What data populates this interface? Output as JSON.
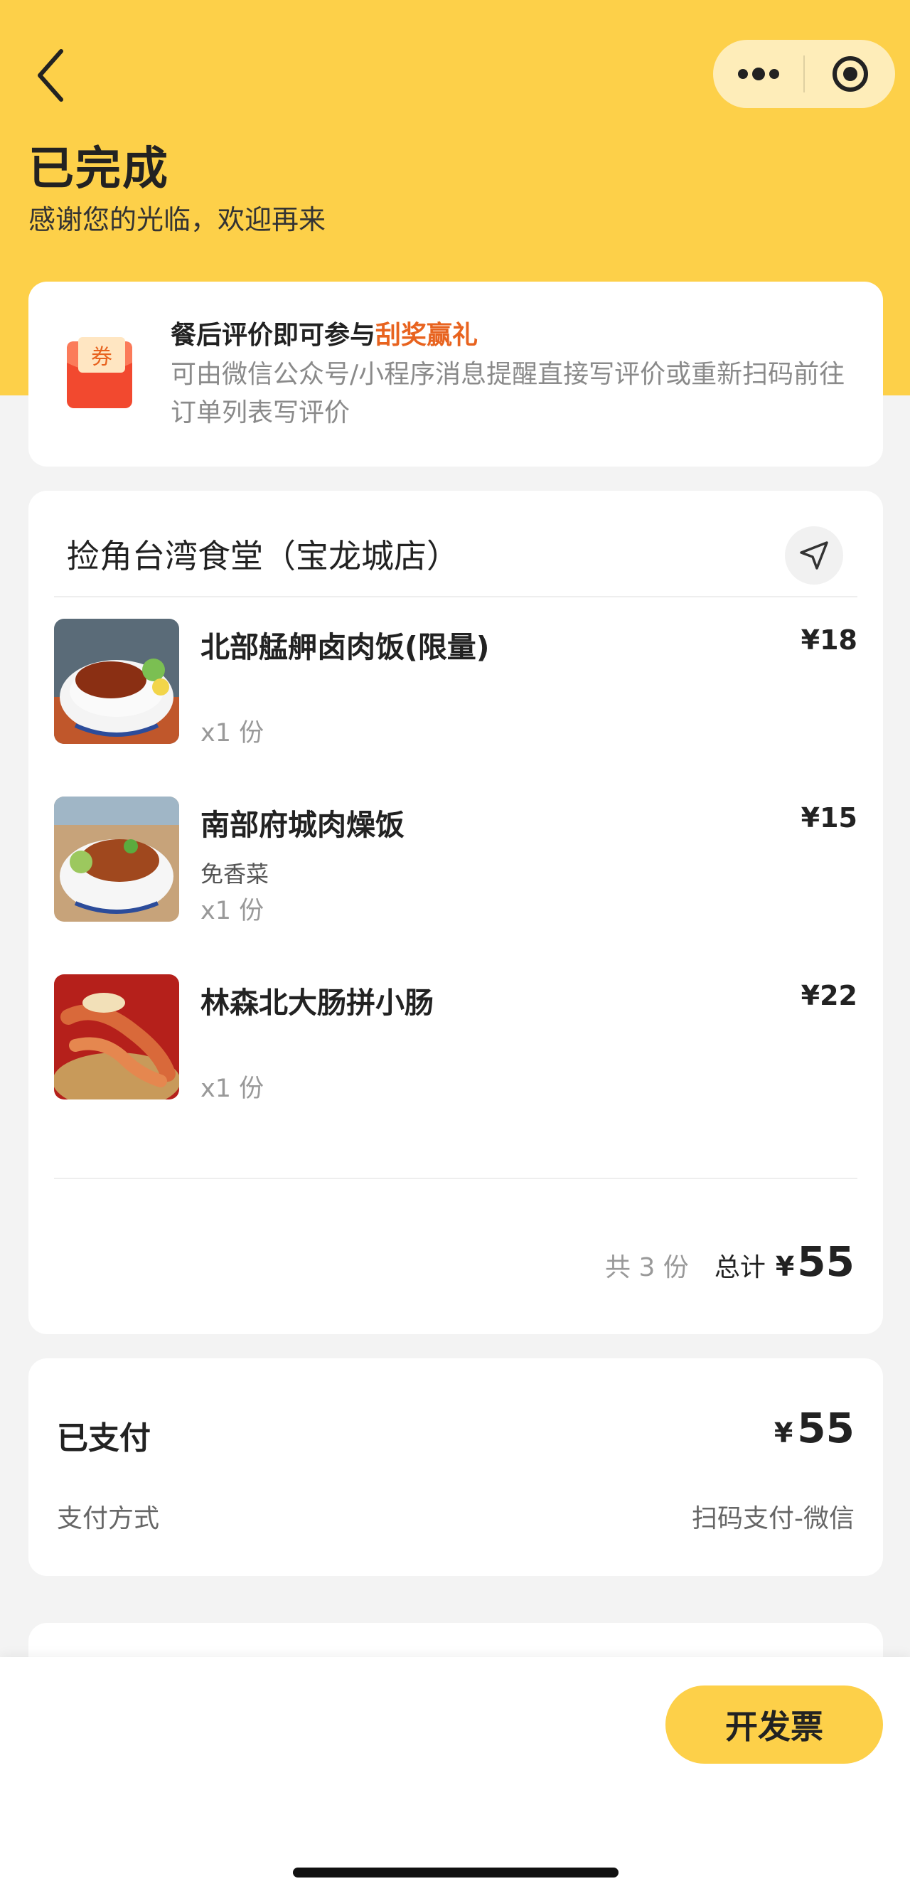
{
  "header": {
    "status_title": "已完成",
    "status_subtitle": "感谢您的光临，欢迎再来",
    "bg_color": "#fdd049"
  },
  "capsule": {
    "more_icon": "more-dots-icon",
    "close_icon": "target-circle-icon"
  },
  "review_banner": {
    "title_prefix": "餐后评价即可参与",
    "title_highlight": "刮奖赢礼",
    "highlight_color": "#e8631f",
    "description": "可由微信公众号/小程序消息提醒直接写评价或重新扫码前往订单列表写评价",
    "icon": "coupon-redpacket-icon",
    "icon_text": "券"
  },
  "order": {
    "shop_name": "捡角台湾食堂（宝龙城店）",
    "nav_icon": "navigation-arrow-icon",
    "items": [
      {
        "name": "北部艋舺卤肉饭(限量)",
        "note": "",
        "qty": "x1 份",
        "price": "¥18"
      },
      {
        "name": "南部府城肉燥饭",
        "note": "免香菜",
        "qty": "x1 份",
        "price": "¥15"
      },
      {
        "name": "林森北大肠拼小肠",
        "note": "",
        "qty": "x1 份",
        "price": "¥22"
      }
    ],
    "summary": {
      "count": "共 3 份",
      "total_label": "总计",
      "currency": "¥",
      "total": "55"
    }
  },
  "payment": {
    "label": "已支付",
    "currency": "¥",
    "amount": "55",
    "method_label": "支付方式",
    "method_value": "扫码支付-微信"
  },
  "bottom": {
    "invoice_button": "开发票",
    "button_color": "#fdd049"
  }
}
